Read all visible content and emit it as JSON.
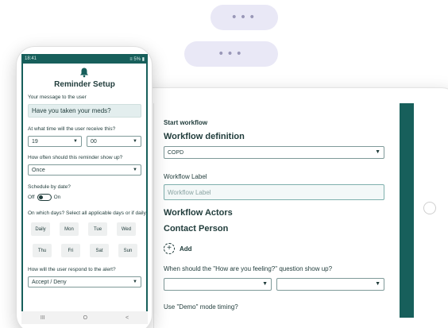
{
  "pills": {
    "dots": "•••"
  },
  "phone": {
    "status": {
      "time": "18:41",
      "indicators": "≡ 5% ▮"
    },
    "title": "Reminder Setup",
    "message_label": "Your message to the user",
    "message_value": "Have you taken your meds?",
    "time_label": "At what time will the user receive this?",
    "hour": "19",
    "minute": "00",
    "frequency_label": "How often should this reminder show up?",
    "frequency": "Once",
    "schedule_label": "Schedule by date?",
    "toggle_off": "Off",
    "toggle_on": "On",
    "days_label": "On which days? Select all applicable days or if daily.",
    "days": [
      "Daily",
      "Mon",
      "Tue",
      "Wed",
      "Thu",
      "Fri",
      "Sat",
      "Sun"
    ],
    "respond_label": "How will the user respond to the alert?",
    "respond": "Accept / Deny",
    "nav": {
      "recent": "III",
      "home": "O",
      "back": "<"
    }
  },
  "tablet": {
    "start_label": "Start workflow",
    "definition_heading": "Workflow definition",
    "definition_value": "COPD",
    "label_heading": "Workflow Label",
    "label_placeholder": "Workflow Label",
    "actors_heading": "Workflow Actors",
    "contact_heading": "Contact Person",
    "add_icon": "+",
    "add_label": "Add",
    "question_label": "When should the \"How are you feeling?\" question show up?",
    "demo_label": "Use \"Demo\" mode timing?"
  },
  "colors": {
    "primary": "#175f5b",
    "text": "#1f3b3a",
    "pill": "#e9e8f6"
  }
}
